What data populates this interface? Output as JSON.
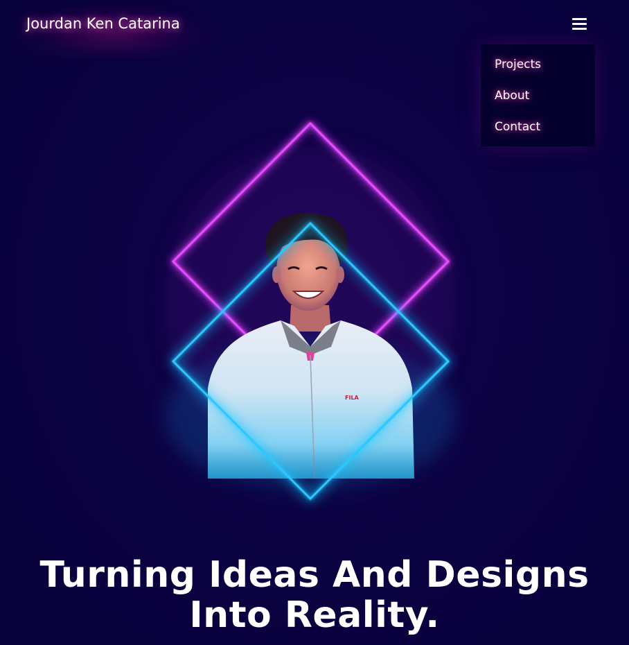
{
  "header": {
    "brand": "Jourdan Ken Catarina",
    "menu_icon": "hamburger-menu-icon"
  },
  "nav": {
    "items": [
      {
        "label": "Projects"
      },
      {
        "label": "About"
      },
      {
        "label": "Contact"
      }
    ]
  },
  "hero": {
    "headline_line1": "Turning Ideas And Designs",
    "headline_line2": "Into Reality.",
    "jacket_logo": "FILA"
  },
  "colors": {
    "background": "#0a0140",
    "neon_purple": "#e64cff",
    "neon_blue": "#29c8ff",
    "text": "#ffffff"
  }
}
